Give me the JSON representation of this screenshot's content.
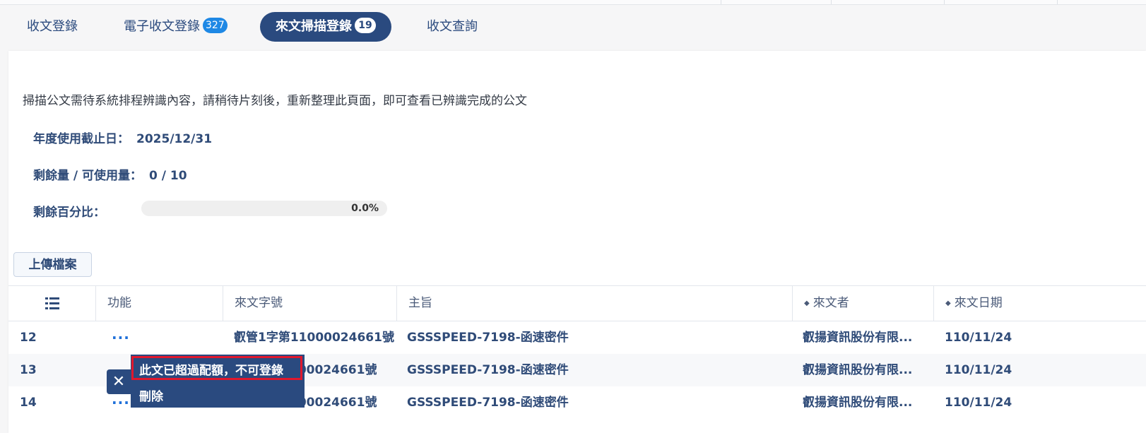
{
  "tabs": [
    {
      "label": "收文登錄",
      "badge": ""
    },
    {
      "label": "電子收文登錄",
      "badge": "327"
    },
    {
      "label": "來文掃描登錄",
      "badge": "19"
    },
    {
      "label": "收文查詢",
      "badge": ""
    }
  ],
  "notice": "掃描公文需待系統排程辨識內容，請稍待片刻後，重新整理此頁面，即可查看已辨識完成的公文",
  "info": {
    "deadline_label": "年度使用截止日：",
    "deadline_value": "2025/12/31",
    "quota_label": "剩餘量 / 可使用量：",
    "quota_value": "0 / 10",
    "percent_label": "剩餘百分比：",
    "percent_value": "0.0%",
    "percent_fraction": 0.0
  },
  "upload_label": "上傳檔案",
  "table": {
    "headers": {
      "function": "功能",
      "doc_no": "來文字號",
      "subject": "主旨",
      "sender": "來文者",
      "date": "來文日期"
    },
    "rows": [
      {
        "idx": "12",
        "action": "···",
        "doc_no": "叡管1字第11000024661號",
        "subject": "GSSSPEED-7198-函速密件",
        "sender": "叡揚資訊股份有限...",
        "date": "110/11/24"
      },
      {
        "idx": "13",
        "action": "",
        "doc_no": "000024661號",
        "subject": "GSSSPEED-7198-函速密件",
        "sender": "叡揚資訊股份有限...",
        "date": "110/11/24"
      },
      {
        "idx": "14",
        "action": "···",
        "doc_no": "000024661號",
        "subject": "GSSSPEED-7198-函速密件",
        "sender": "叡揚資訊股份有限...",
        "date": "110/11/24"
      }
    ]
  },
  "popup": {
    "quota_exceeded": "此文已超過配額，不可登錄",
    "delete": "刪除",
    "close_symbol": "✕"
  },
  "colors": {
    "primary": "#2a4a7f",
    "badge_blue": "#1e88e5",
    "highlight_red": "#e0182d",
    "dots_blue": "#1e6fd9"
  }
}
